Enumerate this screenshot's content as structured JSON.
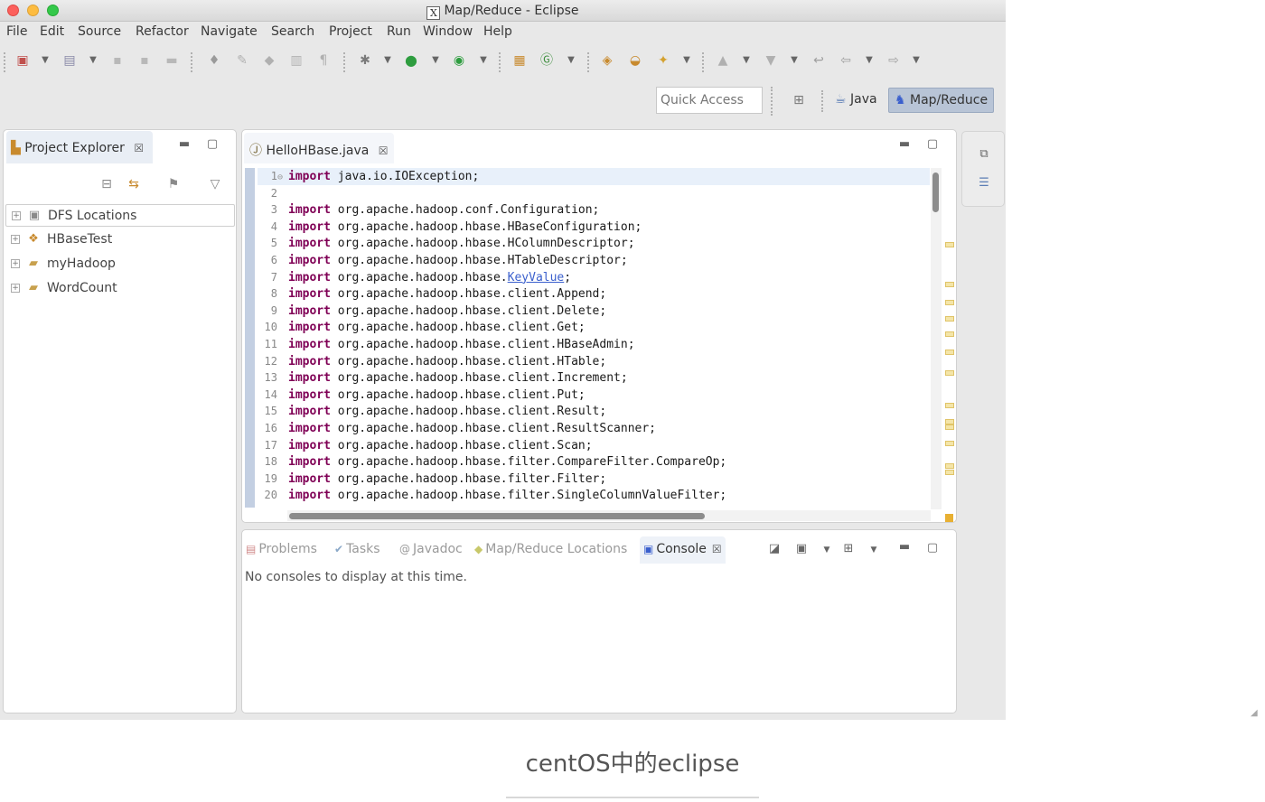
{
  "window": {
    "title": "Map/Reduce - Eclipse",
    "title_icon": "X"
  },
  "menu": [
    "File",
    "Edit",
    "Source",
    "Refactor",
    "Navigate",
    "Search",
    "Project",
    "Run",
    "Window",
    "Help"
  ],
  "quick_access": {
    "placeholder": "Quick Access"
  },
  "perspectives": {
    "java": "Java",
    "mapreduce": "Map/Reduce"
  },
  "project_explorer": {
    "tab_label": "Project Explorer",
    "close_glyph": "☒",
    "items": [
      {
        "label": "DFS Locations",
        "icon": "elephant-db-icon"
      },
      {
        "label": "HBaseTest",
        "icon": "project-icon"
      },
      {
        "label": "myHadoop",
        "icon": "folder-icon"
      },
      {
        "label": "WordCount",
        "icon": "folder-icon"
      }
    ]
  },
  "editor": {
    "tab_label": "HelloHBase.java",
    "close_glyph": "☒",
    "lines": [
      {
        "n": "1",
        "kw": "import",
        "rest": " java.io.IOException;",
        "fold": true,
        "current": true
      },
      {
        "n": "2",
        "kw": "",
        "rest": ""
      },
      {
        "n": "3",
        "kw": "import",
        "rest": " org.apache.hadoop.conf.Configuration;"
      },
      {
        "n": "4",
        "kw": "import",
        "rest": " org.apache.hadoop.hbase.HBaseConfiguration;"
      },
      {
        "n": "5",
        "kw": "import",
        "rest": " org.apache.hadoop.hbase.HColumnDescriptor;"
      },
      {
        "n": "6",
        "kw": "import",
        "rest": " org.apache.hadoop.hbase.HTableDescriptor;"
      },
      {
        "n": "7",
        "kw": "import",
        "rest": " org.apache.hadoop.hbase.",
        "link": "KeyValue",
        "after": ";"
      },
      {
        "n": "8",
        "kw": "import",
        "rest": " org.apache.hadoop.hbase.client.Append;"
      },
      {
        "n": "9",
        "kw": "import",
        "rest": " org.apache.hadoop.hbase.client.Delete;"
      },
      {
        "n": "10",
        "kw": "import",
        "rest": " org.apache.hadoop.hbase.client.Get;"
      },
      {
        "n": "11",
        "kw": "import",
        "rest": " org.apache.hadoop.hbase.client.HBaseAdmin;"
      },
      {
        "n": "12",
        "kw": "import",
        "rest": " org.apache.hadoop.hbase.client.HTable;"
      },
      {
        "n": "13",
        "kw": "import",
        "rest": " org.apache.hadoop.hbase.client.Increment;"
      },
      {
        "n": "14",
        "kw": "import",
        "rest": " org.apache.hadoop.hbase.client.Put;"
      },
      {
        "n": "15",
        "kw": "import",
        "rest": " org.apache.hadoop.hbase.client.Result;"
      },
      {
        "n": "16",
        "kw": "import",
        "rest": " org.apache.hadoop.hbase.client.ResultScanner;"
      },
      {
        "n": "17",
        "kw": "import",
        "rest": " org.apache.hadoop.hbase.client.Scan;"
      },
      {
        "n": "18",
        "kw": "import",
        "rest": " org.apache.hadoop.hbase.filter.CompareFilter.CompareOp;"
      },
      {
        "n": "19",
        "kw": "import",
        "rest": " org.apache.hadoop.hbase.filter.Filter;"
      },
      {
        "n": "20",
        "kw": "import",
        "rest": " org.apache.hadoop.hbase.filter.SingleColumnValueFilter;"
      }
    ]
  },
  "bottom_views": {
    "tabs": [
      {
        "label": "Problems",
        "icon": "problems-icon"
      },
      {
        "label": "Tasks",
        "icon": "tasks-icon"
      },
      {
        "label": "Javadoc",
        "icon": "javadoc-icon"
      },
      {
        "label": "Map/Reduce Locations",
        "icon": "mapreduce-locations-icon"
      },
      {
        "label": "Console",
        "icon": "console-icon",
        "active": true
      }
    ],
    "console_message": "No consoles to display at this time."
  },
  "caption": "centOS中的eclipse",
  "colors": {
    "keyword": "#7f0055",
    "current_line": "#e8f0fa",
    "perspective_active": "#b8c4d6"
  }
}
